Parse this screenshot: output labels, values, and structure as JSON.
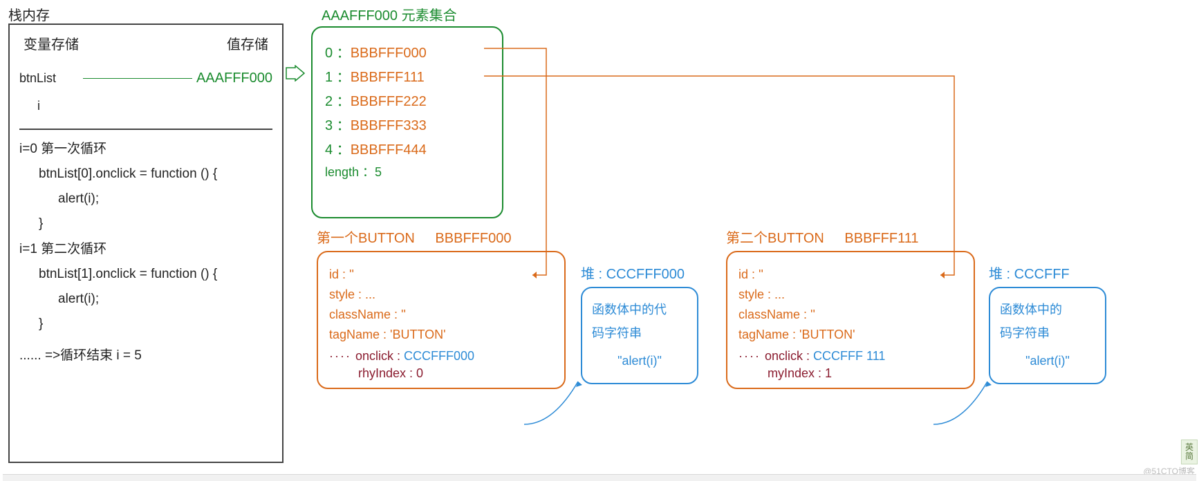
{
  "stack": {
    "title": "栈内存",
    "header_var": "变量存储",
    "header_val": "值存储",
    "btnList_var": "btnList",
    "btnList_ptr": "AAAFFF000",
    "i_var": "i",
    "loop1_head": "i=0  第一次循环",
    "loop1_l1": "btnList[0].onclick = function () {",
    "loop1_l2": "alert(i);",
    "loop1_l3": "}",
    "loop2_head": "i=1 第二次循环",
    "loop2_l1": "btnList[1].onclick = function () {",
    "loop2_l2": "alert(i);",
    "loop2_l3": "}",
    "end": "......   =>循环结束 i = 5"
  },
  "collection": {
    "title": "AAAFFF000 元素集合",
    "rows": [
      {
        "idx": "0",
        "addr": "BBBFFF000"
      },
      {
        "idx": "1",
        "addr": "BBBFFF111"
      },
      {
        "idx": "2",
        "addr": "BBBFFF222"
      },
      {
        "idx": "3",
        "addr": "BBBFFF333"
      },
      {
        "idx": "4",
        "addr": "BBBFFF444"
      }
    ],
    "length": "length ：5"
  },
  "button1": {
    "title": "第一个BUTTON",
    "addr": "BBBFFF000",
    "id": "id : ''",
    "style": "style : ...",
    "class": "className : ''",
    "tag": "tagName : 'BUTTON'",
    "onclick_k": "onclick :",
    "onclick_v": "CCCFFF000",
    "myIndex": "rhyIndex : 0"
  },
  "button2": {
    "title": "第二个BUTTON",
    "addr": "BBBFFF111",
    "id": "id : ''",
    "style": "style : ...",
    "class": "className : ''",
    "tag": "tagName : 'BUTTON'",
    "onclick_k": "onclick :",
    "onclick_v": "CCCFFF 111",
    "myIndex": "myIndex : 1"
  },
  "heap1": {
    "title": "堆 : CCCFFF000",
    "body1": "函数体中的代",
    "body2": "码字符串",
    "alert": "\"alert(i)\""
  },
  "heap2": {
    "title": "堆 : CCCFFF",
    "body1": "函数体中的",
    "body2": "码字符串",
    "alert": "\"alert(i)\""
  },
  "mascot": "@51CTO博客",
  "side_tab": "英 简"
}
